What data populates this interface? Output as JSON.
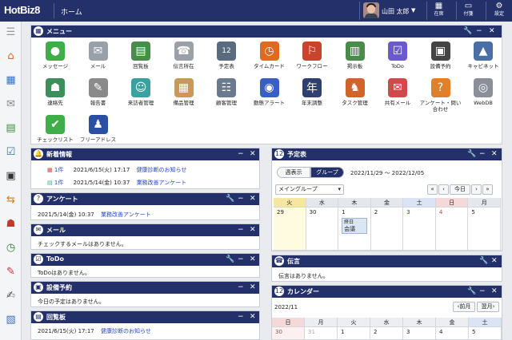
{
  "header": {
    "logo": "HotBiz8",
    "home_link": "ホーム",
    "user_name": "山田 太郎",
    "user_caret": "▼",
    "buttons": [
      {
        "label": "在席",
        "icon": "▦"
      },
      {
        "label": "付箋",
        "icon": "▭"
      },
      {
        "label": "設定",
        "icon": "⚙"
      }
    ]
  },
  "sidebar": {
    "items": [
      {
        "name": "menu-toggle",
        "icon": "☰",
        "color": "#999999"
      },
      {
        "name": "home",
        "icon": "⌂",
        "color": "#e8641e"
      },
      {
        "name": "schedule",
        "icon": "▦",
        "color": "#3a6fc4"
      },
      {
        "name": "mail",
        "icon": "✉",
        "color": "#888888"
      },
      {
        "name": "bulletin",
        "icon": "▤",
        "color": "#3b8f3b"
      },
      {
        "name": "todo",
        "icon": "☑",
        "color": "#3a6fc4"
      },
      {
        "name": "facility",
        "icon": "▣",
        "color": "#333333"
      },
      {
        "name": "workflow",
        "icon": "⇆",
        "color": "#d07a1a"
      },
      {
        "name": "contacts",
        "icon": "☗",
        "color": "#c0392b"
      },
      {
        "name": "timecard",
        "icon": "◷",
        "color": "#2e7d32"
      },
      {
        "name": "memo",
        "icon": "✎",
        "color": "#d32f2f"
      },
      {
        "name": "report",
        "icon": "✍",
        "color": "#555555"
      },
      {
        "name": "notes",
        "icon": "▧",
        "color": "#3a6fc4"
      }
    ]
  },
  "menu": {
    "title": "メニュー",
    "items": [
      {
        "label": "メッセージ",
        "icon": "●",
        "color": "#3fae49"
      },
      {
        "label": "メール",
        "icon": "✉",
        "color": "#9aa0a8"
      },
      {
        "label": "回覧板",
        "icon": "▤",
        "color": "#4a8c4a"
      },
      {
        "label": "伝言所在",
        "icon": "☎",
        "color": "#9aa0a8"
      },
      {
        "label": "予定表",
        "icon": "12",
        "color": "#5a6b80"
      },
      {
        "label": "タイムカード",
        "icon": "◷",
        "color": "#e06a1e"
      },
      {
        "label": "ワークフロー",
        "icon": "⚐",
        "color": "#c8452c"
      },
      {
        "label": "掲示板",
        "icon": "▥",
        "color": "#4a8c4a"
      },
      {
        "label": "ToDo",
        "icon": "☑",
        "color": "#6a5acd"
      },
      {
        "label": "設備予約",
        "icon": "▣",
        "color": "#444444"
      },
      {
        "label": "キャビネット",
        "icon": "▲",
        "color": "#4a6fa5"
      },
      {
        "label": "連絡先",
        "icon": "☗",
        "color": "#3a8f5a"
      },
      {
        "label": "報告書",
        "icon": "✎",
        "color": "#8a8a8a"
      },
      {
        "label": "来訪者管理",
        "icon": "☺",
        "color": "#3aa0a0"
      },
      {
        "label": "備品管理",
        "icon": "▦",
        "color": "#c89a5a"
      },
      {
        "label": "顧客管理",
        "icon": "☷",
        "color": "#6b7a8f"
      },
      {
        "label": "動態アラート",
        "icon": "◉",
        "color": "#3a5fc4"
      },
      {
        "label": "年末調整",
        "icon": "年",
        "color": "#2f3f6f"
      },
      {
        "label": "タスク管理",
        "icon": "♞",
        "color": "#d0642a"
      },
      {
        "label": "共有メール",
        "icon": "✉",
        "color": "#d04a4a"
      },
      {
        "label": "アンケート・問い合わせ",
        "icon": "?",
        "color": "#e0802a"
      },
      {
        "label": "WebDB",
        "icon": "◎",
        "color": "#8a8f98"
      },
      {
        "label": "チェックリスト",
        "icon": "✔",
        "color": "#3fae49"
      },
      {
        "label": "フリーアドレス",
        "icon": "♟",
        "color": "#2a4fa5"
      }
    ]
  },
  "news": {
    "title": "新着情報",
    "rows": [
      {
        "count": "1件",
        "datetime": "2021/6/15(火) 17:17",
        "text": "健康診断のお知らせ"
      },
      {
        "count": "1件",
        "datetime": "2021/5/14(金) 10:37",
        "text": "業務改善アンケート"
      }
    ]
  },
  "survey": {
    "title": "アンケート",
    "row": {
      "datetime": "2021/5/14(金) 10:37",
      "text": "業務改善アンケート"
    }
  },
  "mail": {
    "title": "メール",
    "text": "チェックするメールはありません。"
  },
  "todo": {
    "title": "ToDo",
    "text": "ToDoはありません。"
  },
  "facility": {
    "title": "設備予約",
    "text": "今日の予定はありません。"
  },
  "circular": {
    "title": "回覧板",
    "row": {
      "datetime": "2021/6/15(火) 17:17",
      "text": "健康診断のお知らせ"
    }
  },
  "schedule": {
    "title": "予定表",
    "tab_week": "週表示",
    "tab_group": "グループ",
    "range": "2022/11/29 ～ 2022/12/05",
    "group_select": "メイングループ",
    "nav_prev2": "«",
    "nav_prev": "‹",
    "nav_today": "今日",
    "nav_next": "›",
    "nav_next2": "»",
    "days": [
      {
        "label": "火",
        "date": "29",
        "color": "#f5e6a0",
        "bg": "#fffbe0"
      },
      {
        "label": "水",
        "date": "30",
        "color": "#e4e7ec",
        "bg": "#ffffff"
      },
      {
        "label": "木",
        "date": "1",
        "color": "#e4e7ec",
        "bg": "#ffffff"
      },
      {
        "label": "金",
        "date": "2",
        "color": "#e4e7ec",
        "bg": "#ffffff"
      },
      {
        "label": "土",
        "date": "3",
        "color": "#dbe4f5",
        "bg": "#ffffff"
      },
      {
        "label": "日",
        "date": "4",
        "color": "#f5d8d8",
        "bg": "#ffffff"
      },
      {
        "label": "月",
        "date": "5",
        "color": "#e4e7ec",
        "bg": "#ffffff"
      }
    ],
    "event": {
      "tag": "終日",
      "text": "会議"
    }
  },
  "message": {
    "title": "伝言",
    "text": "伝言はありません。"
  },
  "calendar": {
    "title": "カレンダー",
    "month": "2022/11",
    "prev": "‹前月",
    "next": "翌月›",
    "weekdays": [
      "日",
      "月",
      "火",
      "水",
      "木",
      "金",
      "土"
    ],
    "row1": [
      "30",
      "31",
      "1",
      "2",
      "3",
      "4",
      "5"
    ]
  },
  "colors": {
    "nav": "#23306a",
    "link": "#2547c4",
    "accent": "#f0a020"
  }
}
